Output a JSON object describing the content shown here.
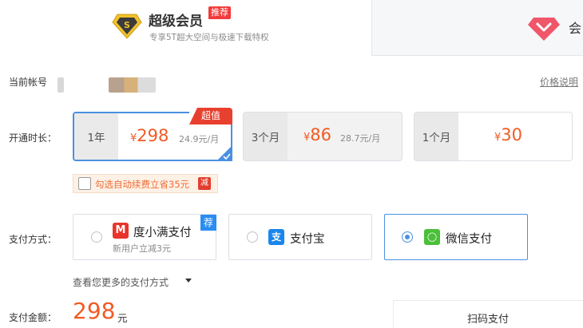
{
  "tabs": {
    "svip": {
      "title": "超级会员",
      "badge": "推荐",
      "subtitle": "专享5T超大空间与极速下载特权",
      "icon_letter": "S"
    },
    "vip": {
      "title": "会"
    }
  },
  "account": {
    "label": "当前帐号",
    "price_link": "价格说明"
  },
  "duration": {
    "label": "开通时长：",
    "options": [
      {
        "period": "1年",
        "currency": "¥",
        "price": "298",
        "unit_price": "24.9元/月",
        "badge": "超值",
        "selected": true
      },
      {
        "period": "3个月",
        "currency": "¥",
        "price": "86",
        "unit_price": "28.7元/月",
        "selected": false
      },
      {
        "period": "1个月",
        "currency": "¥",
        "price": "30",
        "unit_price": "",
        "selected": false
      }
    ]
  },
  "auto_renew": {
    "text": "勾选自动续费立省35元",
    "tag": "减",
    "checked": false
  },
  "payment": {
    "label": "支付方式：",
    "methods": [
      {
        "name": "度小满支付",
        "sub": "新用户立减3元",
        "tag": "荐",
        "icon": "duxiaoman-icon",
        "icon_glyph": "M",
        "color": "#e8352b",
        "selected": false
      },
      {
        "name": "支付宝",
        "icon": "alipay-icon",
        "icon_glyph": "支",
        "color": "#1a86ec",
        "selected": false
      },
      {
        "name": "微信支付",
        "icon": "wechat-pay-icon",
        "icon_glyph": "◯",
        "color": "#4cbf3a",
        "selected": true
      }
    ],
    "more_link": "查看您更多的支付方式"
  },
  "amount": {
    "label": "支付金额：",
    "value": "298",
    "unit": "元"
  },
  "scan": {
    "label": "扫码支付"
  },
  "colors": {
    "accent": "#4a90e2",
    "price": "#f25a24",
    "hot": "#e8402e"
  }
}
